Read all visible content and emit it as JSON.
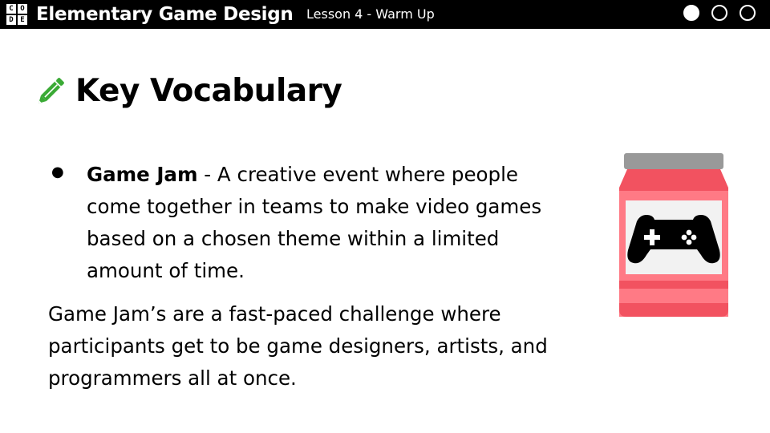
{
  "header": {
    "logo_letters": [
      "C",
      "O",
      "D",
      "E"
    ],
    "course_title": "Elementary Game Design",
    "lesson_label": "Lesson 4 - Warm Up",
    "progress": {
      "total": 3,
      "current": 1
    }
  },
  "slide": {
    "heading": "Key Vocabulary",
    "heading_icon": "pencil-icon",
    "bullet": {
      "term": "Game Jam",
      "separator": " - ",
      "definition": "A creative event where people come together in teams to make video games based on a chosen theme within a limited amount of time."
    },
    "paragraph": "Game Jam’s are a fast-paced challenge where participants get to be game designers, artists, and programmers all at once.",
    "illustration_icon": "game-jam-jar-icon"
  },
  "colors": {
    "topbar": "#000000",
    "pencil_green": "#3aaa35",
    "jar_red": "#f25260",
    "jar_light_red": "#ff7a85",
    "jar_lid": "#999999",
    "jar_label": "#f2f2f2"
  }
}
